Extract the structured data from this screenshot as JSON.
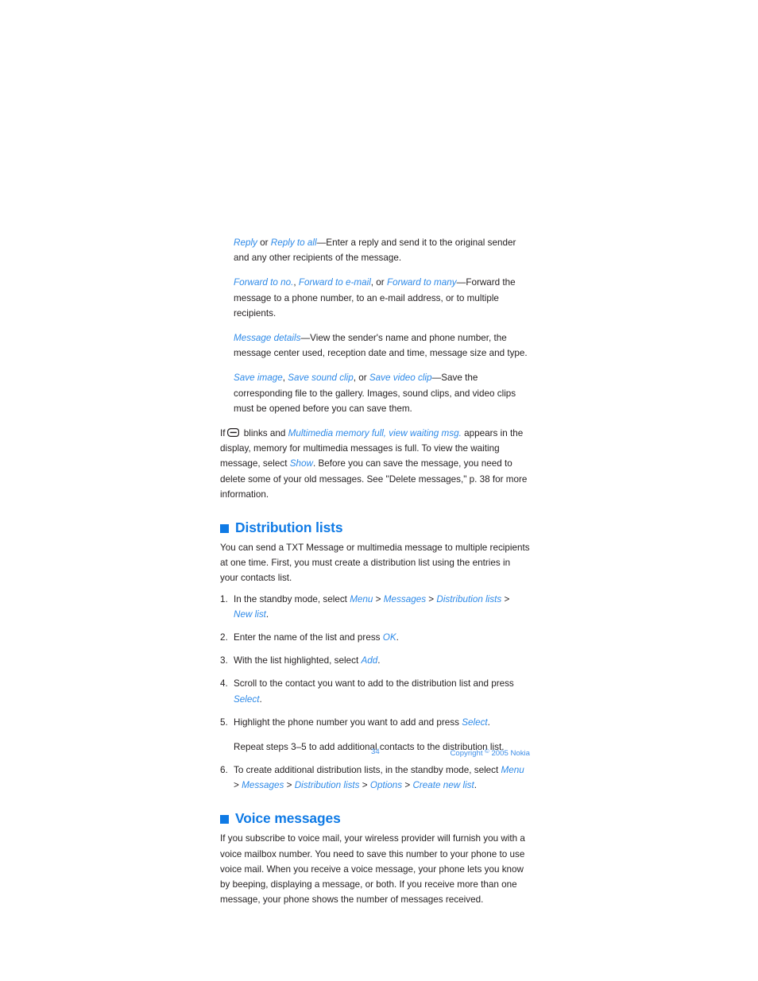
{
  "page": {
    "number": "34",
    "copyright_prefix": "Copyright",
    "copyright_symbol": "©",
    "copyright_suffix": "2005 Nokia"
  },
  "options_paragraphs": [
    {
      "terms": [
        "Reply",
        "Reply to all"
      ],
      "text": "Reply or Reply to all—Enter a reply and send it to the original sender and any other recipients of the message."
    },
    {
      "terms": [
        "Forward to no.",
        "Forward to e-mail",
        "Forward to many"
      ],
      "text": "Forward to no., Forward to e-mail, or Forward to many—Forward the message to a phone number, to an e-mail address, or to multiple recipients."
    },
    {
      "terms": [
        "Message details"
      ],
      "text": "Message details—View the sender's name and phone number, the message center used, reception date and time, message size and type."
    },
    {
      "terms": [
        "Save image",
        "Save sound clip",
        "Save video clip"
      ],
      "text": "Save image, Save sound clip, or Save video clip—Save the corresponding file to the gallery. Images, sound clips, and video clips must be opened before you can save them."
    }
  ],
  "memory_note": {
    "lead": "If",
    "icon": "message-envelope-icon",
    "after_icon": "blinks and",
    "message_term": "Multimedia memory full, view waiting msg.",
    "body_1": "appears in the display, memory for multimedia messages is full. To view the waiting message, select",
    "show_term": "Show",
    "body_2": ". Before you can save the message, you need to delete some of your old messages. See \"Delete messages,\" p. 38 for more information."
  },
  "distribution_lists": {
    "heading": "Distribution lists",
    "intro": "You can send a TXT Message or multimedia message to multiple recipients at one time. First, you must create a distribution list using the entries in your contacts list.",
    "steps": [
      {
        "num": "1.",
        "prefix": "In the standby mode, select ",
        "path": [
          "Menu",
          "Messages",
          "Distribution lists",
          "New list"
        ],
        "suffix": "."
      },
      {
        "num": "2.",
        "prefix": "Enter the name of the list and press ",
        "path": [
          "OK"
        ],
        "suffix": "."
      },
      {
        "num": "3.",
        "prefix": "With the list highlighted, select ",
        "path": [
          "Add"
        ],
        "suffix": "."
      },
      {
        "num": "4.",
        "prefix": "Scroll to the contact you want to add to the distribution list and press ",
        "path": [
          "Select"
        ],
        "suffix": "."
      },
      {
        "num": "5.",
        "prefix": "Highlight the phone number you want to add and press ",
        "path": [
          "Select"
        ],
        "suffix": "."
      },
      {
        "num": "6.",
        "prefix": "To create additional distribution lists, in the standby mode, select ",
        "path": [
          "Menu",
          "Messages",
          "Distribution lists",
          "Options",
          "Create new list"
        ],
        "suffix": "."
      }
    ],
    "repeat_note": "Repeat steps 3–5 to add additional contacts to the distribution list."
  },
  "voice_messages": {
    "heading": "Voice messages",
    "body": "If you subscribe to voice mail, your wireless provider will furnish you with a voice mailbox number. You need to save this number to your phone to use voice mail. When you receive a voice message, your phone lets you know by beeping, displaying a message, or both. If you receive more than one message, your phone shows the number of messages received."
  },
  "colors": {
    "heading_blue": "#0f7ae5",
    "link_blue": "#2e8ae8",
    "footer_blue": "#3e8ee8",
    "body_text": "#231f20"
  }
}
